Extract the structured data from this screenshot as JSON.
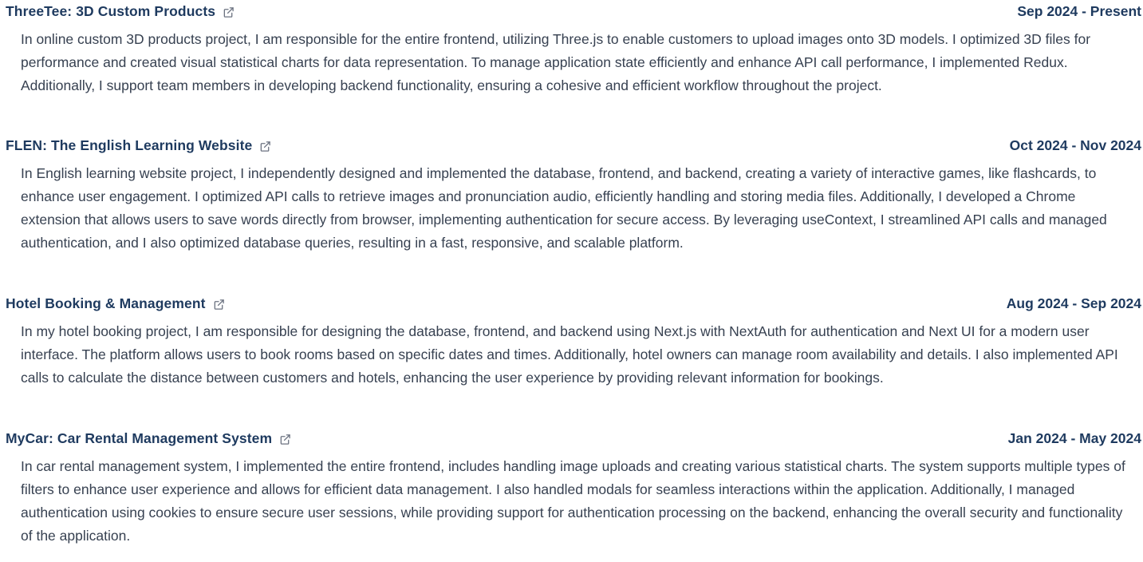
{
  "projects": [
    {
      "title": "ThreeTee: 3D Custom Products",
      "date": "Sep 2024 - Present",
      "description": "In online custom 3D products project, I am responsible for the entire frontend, utilizing Three.js to enable customers to upload images onto 3D models. I optimized 3D files for performance and created visual statistical charts for data representation. To manage application state efficiently and enhance API call performance, I implemented Redux. Additionally, I support team members in developing backend functionality, ensuring a cohesive and efficient workflow throughout the project."
    },
    {
      "title": "FLEN: The English Learning Website",
      "date": "Oct 2024 - Nov 2024",
      "description": "In English learning website project, I independently designed and implemented the database, frontend, and backend, creating a variety of interactive games, like flashcards, to enhance user engagement. I optimized API calls to retrieve images and pronunciation audio, efficiently handling and storing media files. Additionally, I developed a Chrome extension that allows users to save words directly from browser, implementing authentication for secure access. By leveraging useContext, I streamlined API calls and managed authentication, and I also optimized database queries, resulting in a fast, responsive, and scalable platform."
    },
    {
      "title": "Hotel Booking & Management",
      "date": "Aug 2024 - Sep 2024",
      "description": "In my hotel booking project, I am responsible for designing the database, frontend, and backend using Next.js with NextAuth for authentication and Next UI for a modern user interface. The platform allows users to book rooms based on specific dates and times. Additionally, hotel owners can manage room availability and details. I also implemented API calls to calculate the distance between customers and hotels, enhancing the user experience by providing relevant information for bookings."
    },
    {
      "title": "MyCar: Car Rental Management System",
      "date": "Jan 2024 - May 2024",
      "description": "In car rental management system, I implemented the entire frontend, includes handling image uploads and creating various statistical charts. The system supports multiple types of filters to enhance user experience and allows for efficient data management. I also handled modals for seamless interactions within the application. Additionally, I managed authentication using cookies to ensure secure user sessions, while providing support for authentication processing on the backend, enhancing the overall security and functionality of the application."
    }
  ],
  "icons": {
    "external_link": "external-link-icon"
  },
  "colors": {
    "heading": "#1e3a5f",
    "body_text": "#374151",
    "icon": "#6b7280"
  }
}
